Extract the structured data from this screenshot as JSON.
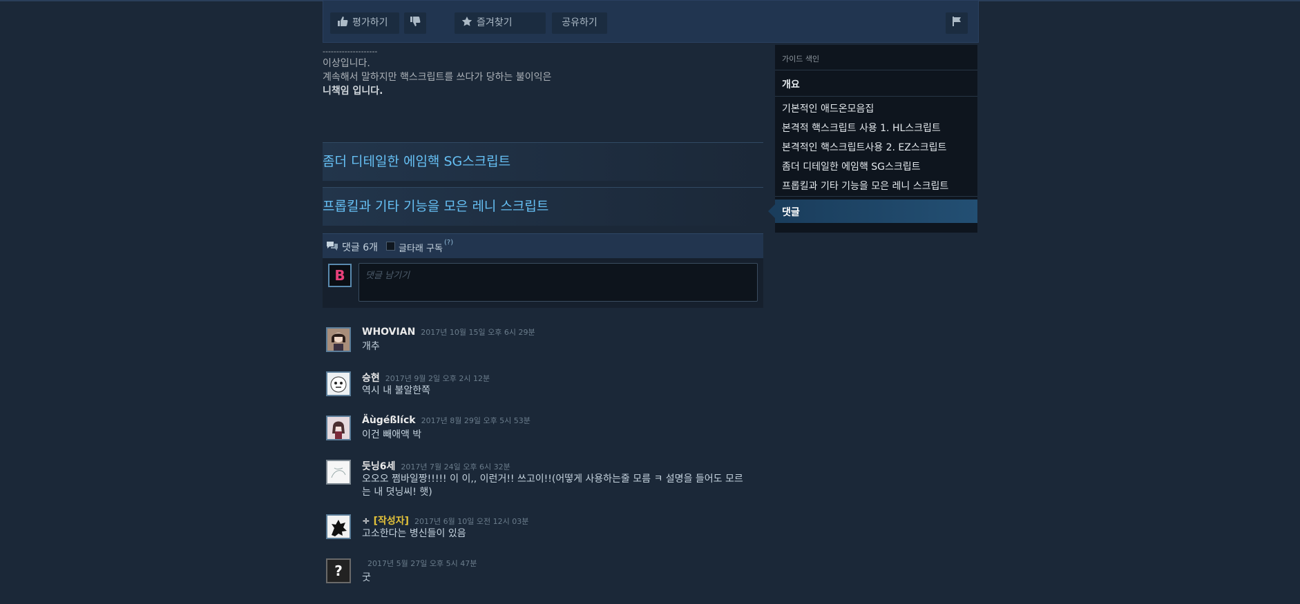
{
  "toolbar": {
    "rate_label": "평가하기",
    "favorite_label": "즐겨찾기",
    "share_label": "공유하기"
  },
  "content": {
    "divider_text": "--------------------",
    "line1": "이상입니다.",
    "line2": "계속해서 말하지만 핵스크립트를 쓰다가 당하는 불이익은",
    "line3": "니책임 입니다."
  },
  "sections": [
    {
      "title": "좀더 디테일한 에임핵 SG스크립트"
    },
    {
      "title": "프롭킬과 기타 기능을 모은 레니 스크립트"
    }
  ],
  "comments_header": {
    "count_label": "댓글 6개",
    "subscribe_label": "글타래 구독",
    "help_label": "(?)"
  },
  "compose": {
    "placeholder": "댓글 남기기",
    "avatar_letter": "B"
  },
  "comments": [
    {
      "name": "WHOVIAN",
      "time": "2017년 10월 15일 오후 6시 29분",
      "text": "개추",
      "avatar_color": "#6b4a3a"
    },
    {
      "name": "승현",
      "time": "2017년 9월 2일 오후 2시 12분",
      "text": "역시 내 불알한쪽",
      "avatar_color": "#e8ecef"
    },
    {
      "name": "Äùgéßlíck",
      "time": "2017년 8월 29일 오후 5시 53분",
      "text": "이건 빼애액 박",
      "avatar_color": "#d8c4c8"
    },
    {
      "name": "듯닝6세",
      "time": "2017년 7월 24일 오후 6시 32분",
      "text": "오오오 쩜바일짱!!!!! 이 이,, 이런거!! 쓰고이!!(어떻게 사용하는줄 모름 ㅋ 설명을 들어도 모르는 내 뎟닝씨! 햇)",
      "avatar_color": "#f4f4f4"
    },
    {
      "name": "÷",
      "author_tag": "[작성자]",
      "time": "2017년 6월 10일 오전 12시 03분",
      "text": "고소한다는 병신들이 있음",
      "avatar_color": "#f0f0f0"
    },
    {
      "name": "",
      "time": "2017년 5월 27일 오후 5시 47분",
      "text": "굿",
      "avatar_color": "#222222",
      "avatar_glyph": "?"
    }
  ],
  "sidebar": {
    "header": "가이드 색인",
    "overview": "개요",
    "items": [
      "기본적인 애드온모음집",
      "본격적 핵스크립트 사용 1. HL스크립트",
      "본격적인 핵스크립트사용 2. EZ스크립트",
      "좀더 디테일한 에임핵 SG스크립트",
      "프롭킬과 기타 기능을 모은 레니 스크립트"
    ],
    "active": "댓글"
  },
  "colors": {
    "background": "#1b2838",
    "link": "#66c0f4",
    "author": "#e4c33a"
  }
}
